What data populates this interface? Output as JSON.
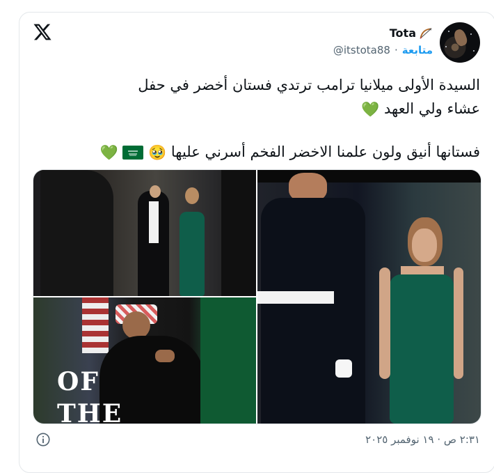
{
  "author": {
    "name": "Tota",
    "handle": "@itstota88",
    "follow_label": "متابعة",
    "separator": "·"
  },
  "tweet": {
    "line1": "السيدة الأولى ميلانيا ترامب ترتدي فستان أخضر في حفل",
    "line2": "عشاء ولي العهد",
    "line3": "فستانها أنيق ولون علمنا الاخضر الفخم أسرني عليها",
    "emoji_heart": "💚",
    "emoji_pleading": "🥹"
  },
  "media": {
    "overlay_text_1": "OF",
    "overlay_text_2": "THE"
  },
  "timestamp": "٢:٣١ ص · ١٩ نوفمبر ٢٠٢٥",
  "icons": [
    "x-logo-icon",
    "bow-and-arrow-icon",
    "saudi-flag-icon",
    "info-icon"
  ],
  "colors": {
    "link_blue": "#1d9bf0",
    "secondary_text": "#536471",
    "dress_green": "#0f5e4a",
    "heart_green": "#59a83a"
  }
}
